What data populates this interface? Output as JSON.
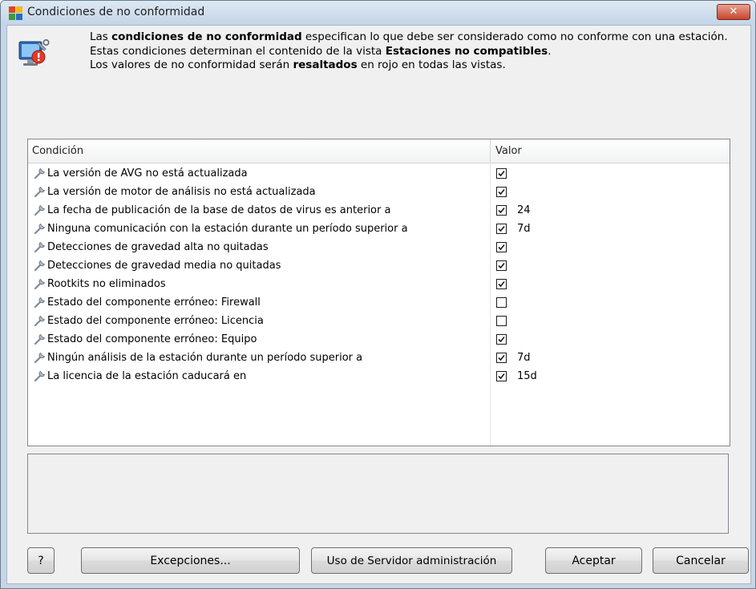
{
  "window": {
    "title": "Condiciones de no conformidad",
    "close_label": "✕"
  },
  "description": {
    "line1_pre": "Las ",
    "line1_bold": "condiciones de no conformidad",
    "line1_post": " especifican lo que debe ser considerado como no conforme con una estación.",
    "line2_pre": "Estas condiciones determinan el contenido de la vista ",
    "line2_bold": "Estaciones no compatibles",
    "line2_post": ".",
    "line3_pre": "Los valores de no conformidad serán ",
    "line3_bold": "resaltados",
    "line3_post": " en rojo en todas las vistas."
  },
  "table": {
    "headers": {
      "condition": "Condición",
      "value": "Valor"
    },
    "rows": [
      {
        "label": "La versión de AVG no está actualizada",
        "checked": true,
        "value": ""
      },
      {
        "label": "La versión de motor de análisis no está actualizada",
        "checked": true,
        "value": ""
      },
      {
        "label": "La fecha de publicación de la base de datos de virus es anterior a",
        "checked": true,
        "value": "24"
      },
      {
        "label": "Ninguna comunicación con la estación durante un período superior a",
        "checked": true,
        "value": "7d"
      },
      {
        "label": "Detecciones de gravedad alta no quitadas",
        "checked": true,
        "value": ""
      },
      {
        "label": "Detecciones de gravedad media no quitadas",
        "checked": true,
        "value": ""
      },
      {
        "label": "Rootkits no eliminados",
        "checked": true,
        "value": ""
      },
      {
        "label": "Estado del componente erróneo: Firewall",
        "checked": false,
        "value": ""
      },
      {
        "label": "Estado del componente erróneo: Licencia",
        "checked": false,
        "value": ""
      },
      {
        "label": "Estado del componente erróneo: Equipo",
        "checked": true,
        "value": ""
      },
      {
        "label": "Ningún análisis de la estación durante un período superior a",
        "checked": true,
        "value": "7d"
      },
      {
        "label": "La licencia de la estación caducará en",
        "checked": true,
        "value": "15d"
      }
    ]
  },
  "buttons": {
    "help": "?",
    "exceptions": "Excepciones...",
    "admin_server": "Uso de Servidor administración",
    "accept": "Aceptar",
    "cancel": "Cancelar"
  },
  "icons": {
    "app": "avg-logo-icon",
    "header": "monitor-settings-warning-icon",
    "row": "wrench-icon"
  }
}
